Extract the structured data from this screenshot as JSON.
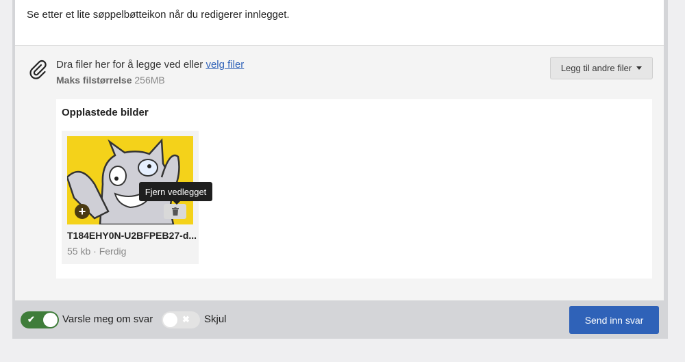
{
  "message": {
    "text": "Se etter et lite søppelbøtteikon når du redigerer innlegget."
  },
  "uploader": {
    "drop_text": "Dra filer her for å legge ved eller ",
    "choose_link": "velg filer",
    "max_size_label": "Maks filstørrelse",
    "max_size_value": "256MB",
    "add_files_button": "Legg til andre filer",
    "icon": "paperclip-icon"
  },
  "images": {
    "title": "Opplastede bilder",
    "files": [
      {
        "name": "T184EHY0N-U2BFPEB27-d...",
        "meta": "55 kb · Ferdig"
      }
    ]
  },
  "tooltip": {
    "text": "Fjern vedlegget"
  },
  "footer": {
    "notify_label": "Varsle meg om svar",
    "notify_on": true,
    "hide_label": "Skjul",
    "hide_on": false,
    "submit_label": "Send inn svar"
  },
  "colors": {
    "primary": "#2f62b8",
    "toggle_on": "#3f7d3a",
    "thumb_bg": "#f4d21a"
  }
}
